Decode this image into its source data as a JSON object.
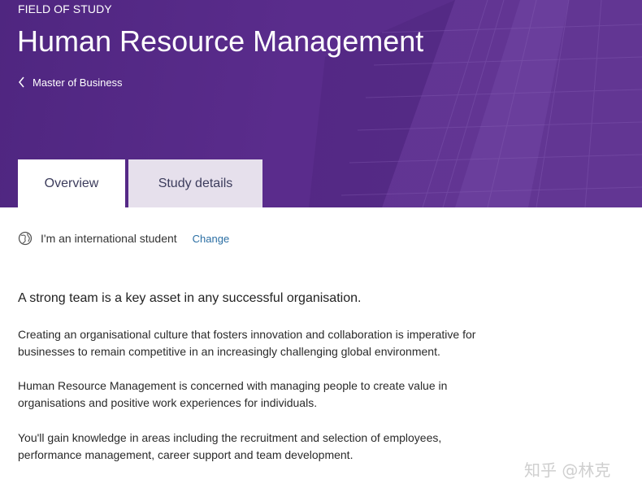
{
  "hero": {
    "eyebrow": "FIELD OF STUDY",
    "title": "Human Resource Management",
    "breadcrumb": "Master of Business",
    "background_color": "#5a2c8c"
  },
  "tabs": [
    {
      "label": "Overview",
      "active": true
    },
    {
      "label": "Study details",
      "active": false
    }
  ],
  "student_status": {
    "label": "I'm an international student",
    "change_link": "Change",
    "icon": "globe-icon"
  },
  "content": {
    "lead": "A strong team is a key asset in any successful organisation.",
    "paragraphs": [
      "Creating an organisational culture that fosters innovation and collaboration is imperative for businesses to remain competitive in an increasingly challenging global environment.",
      "Human Resource Management is concerned with managing people to create value in organisations and positive work experiences for individuals.",
      "You'll gain knowledge in areas including the recruitment and selection of employees, performance management, career support and team development."
    ]
  },
  "watermark": "知乎 @林克",
  "colors": {
    "accent_purple": "#5a2c8c",
    "link_blue": "#2a6ea3",
    "inactive_tab": "#e6e0ec"
  }
}
